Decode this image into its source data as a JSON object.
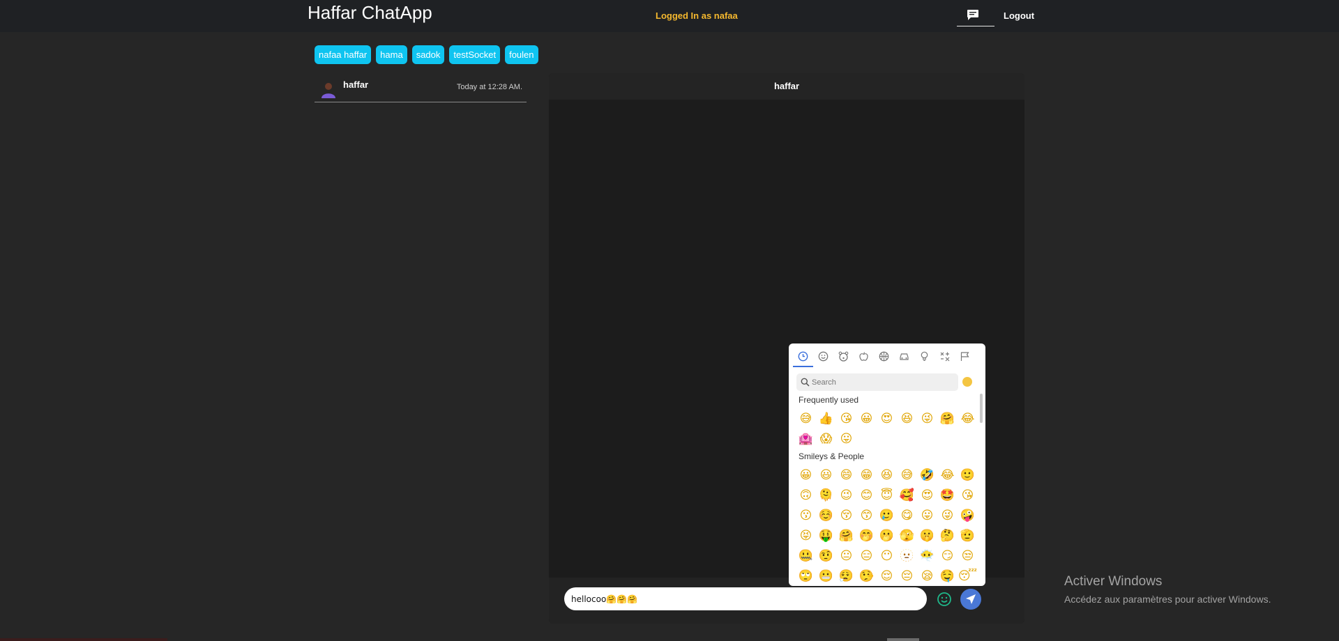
{
  "app": {
    "title": "Haffar ChatApp",
    "logged_in": "Logged In as nafaa",
    "logout_label": "Logout"
  },
  "users": [
    "nafaa haffar",
    "hama",
    "sadok",
    "testSocket",
    "foulen"
  ],
  "conversation": {
    "name": "haffar",
    "time": "Today at 12:28 AM."
  },
  "chat": {
    "header": "haffar",
    "input_value": "hellocoo🤗🤗🤗"
  },
  "emoji_picker": {
    "search_placeholder": "Search",
    "sections": [
      {
        "label": "Frequently used",
        "emojis": [
          "😅",
          "👍",
          "😘",
          "😀",
          "😍",
          "😆",
          "😜",
          "🤗",
          "😂",
          "🏩",
          "😱",
          "😛"
        ]
      },
      {
        "label": "Smileys & People",
        "emojis": [
          "😀",
          "😃",
          "😄",
          "😁",
          "😆",
          "😅",
          "🤣",
          "😂",
          "🙂",
          "🙃",
          "🫠",
          "😉",
          "😊",
          "😇",
          "🥰",
          "😍",
          "🤩",
          "😘",
          "😗",
          "☺️",
          "😚",
          "😙",
          "🥲",
          "😋",
          "😛",
          "😜",
          "🤪",
          "😝",
          "🤑",
          "🤗",
          "🤭",
          "🫢",
          "🫣",
          "🤫",
          "🤔",
          "🫡",
          "🤐",
          "🤨",
          "😐",
          "😑",
          "😶",
          "🫥",
          "😶‍🌫️",
          "😏",
          "😒",
          "🙄",
          "😬",
          "😮‍💨",
          "🤥",
          "😌",
          "😔",
          "😪",
          "🤤",
          "😴"
        ]
      }
    ]
  },
  "watermark": {
    "title": "Activer Windows",
    "subtitle": "Accédez aux paramètres pour activer Windows."
  },
  "colors": {
    "accent_chip": "#0fc4f0",
    "logged_in_text": "#f5b82e",
    "send_button": "#4a78d6"
  }
}
